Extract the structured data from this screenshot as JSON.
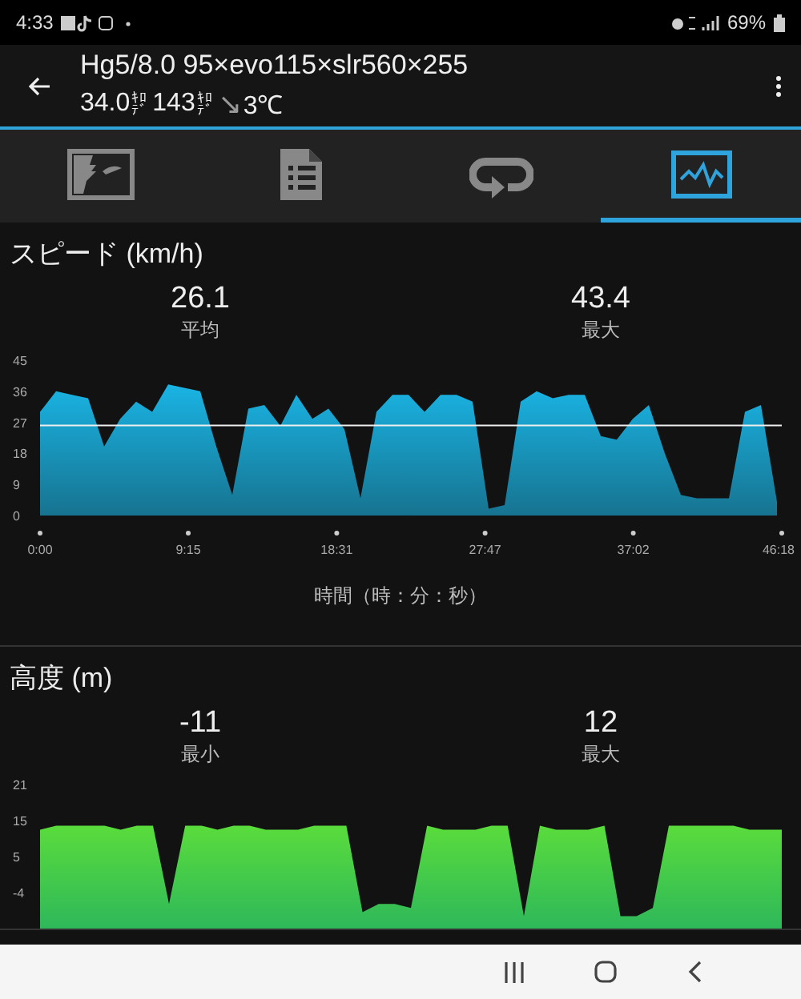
{
  "status_bar": {
    "time": "4:33",
    "battery": "69%"
  },
  "app_bar": {
    "title": "Hg5/8.0 95×evo115×slr560×255",
    "subtitle": [
      {
        "value": "34.0",
        "unit": "ｷﾛﾃﾞ"
      },
      {
        "value": "143",
        "unit": "ｷﾛﾃﾞ"
      }
    ],
    "wind_arrow": "↘",
    "temperature": "3℃"
  },
  "tabs": [
    {
      "kind": "map",
      "selected": false
    },
    {
      "kind": "document",
      "selected": false
    },
    {
      "kind": "loop",
      "selected": false
    },
    {
      "kind": "chart",
      "selected": true
    }
  ],
  "sections": [
    {
      "title": "スピード (km/h)",
      "stats": [
        {
          "value": "26.1",
          "label": "平均"
        },
        {
          "value": "43.4",
          "label": "最大"
        }
      ],
      "chart_data": {
        "type": "area",
        "xlabel": "時間（時：分：秒）",
        "x": [
          0,
          1,
          2,
          3,
          4,
          5,
          6,
          7,
          8,
          9,
          10,
          11,
          12,
          13,
          14,
          15,
          16,
          17,
          18,
          19,
          20,
          21,
          22,
          23,
          24,
          25,
          26,
          27,
          28,
          29,
          30,
          31,
          32,
          33,
          34,
          35,
          36,
          37,
          38,
          39,
          40,
          41,
          42,
          43,
          44,
          45,
          46
        ],
        "series": [
          {
            "color": "#1ab4e4",
            "values": [
              30,
              36,
              35,
              34,
              20,
              28,
              33,
              30,
              38,
              37,
              36,
              20,
              6,
              31,
              32,
              26,
              35,
              28,
              31,
              25,
              5,
              30,
              35,
              35,
              30,
              35,
              35,
              33,
              2,
              3,
              33,
              36,
              34,
              35,
              35,
              23,
              22,
              28,
              32,
              18,
              6,
              5,
              5,
              5,
              30,
              32,
              4
            ]
          }
        ],
        "xlim": [
          0,
          46.3
        ],
        "ylim": [
          0,
          45
        ],
        "yticks": [
          0,
          9,
          18,
          27,
          36,
          45
        ],
        "xticks": [
          {
            "value": 0,
            "label": "0:00"
          },
          {
            "value": 9.25,
            "label": "9:15"
          },
          {
            "value": 18.52,
            "label": "18:31"
          },
          {
            "value": 27.78,
            "label": "27:47"
          },
          {
            "value": 37.03,
            "label": "37:02"
          },
          {
            "value": 46.3,
            "label": "46:18"
          }
        ]
      }
    },
    {
      "title": "高度 (m)",
      "stats": [
        {
          "value": "-11",
          "label": "最小"
        },
        {
          "value": "12",
          "label": "最大"
        }
      ],
      "y_labels": [
        "21",
        "15",
        "5",
        "-4"
      ]
    }
  ]
}
